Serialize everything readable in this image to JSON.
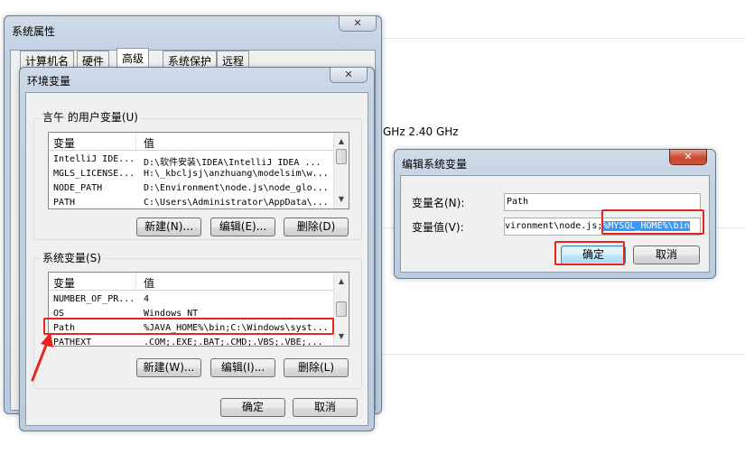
{
  "background": {
    "cpu_text": "GHz   2.40 GHz"
  },
  "system_properties": {
    "title": "系统属性",
    "tabs": [
      "计算机名",
      "硬件",
      "高级",
      "系统保护",
      "远程"
    ],
    "active_tab": 2
  },
  "env_dialog": {
    "title": "环境变量",
    "user_group_label": "言午 的用户变量(U)",
    "columns": [
      "变量",
      "值"
    ],
    "user_vars": [
      {
        "name": "IntelliJ IDE...",
        "value": "D:\\软件安装\\IDEA\\IntelliJ IDEA ..."
      },
      {
        "name": "MGLS_LICENSE...",
        "value": "H:\\_kbcljsj\\anzhuang\\modelsim\\w..."
      },
      {
        "name": "NODE_PATH",
        "value": "D:\\Environment\\node.js\\node_glo..."
      },
      {
        "name": "PATH",
        "value": "C:\\Users\\Administrator\\AppData\\..."
      }
    ],
    "user_buttons": [
      "新建(N)...",
      "编辑(E)...",
      "删除(D)"
    ],
    "system_group_label": "系统变量(S)",
    "system_vars": [
      {
        "name": "NUMBER_OF_PR...",
        "value": "4"
      },
      {
        "name": "OS",
        "value": "Windows_NT"
      },
      {
        "name": "Path",
        "value": "%JAVA_HOME%\\bin;C:\\Windows\\syst..."
      },
      {
        "name": "PATHEXT",
        "value": ".COM;.EXE;.BAT;.CMD;.VBS;.VBE;..."
      }
    ],
    "system_buttons": [
      "新建(W)...",
      "编辑(I)...",
      "删除(L)"
    ],
    "ok_label": "确定",
    "cancel_label": "取消"
  },
  "edit_dialog": {
    "title": "编辑系统变量",
    "name_label": "变量名(N):",
    "name_value": "Path",
    "value_label": "变量值(V):",
    "value_text": "vironment\\node.js;",
    "value_selected": "%MYSQL_HOME%\\bin",
    "ok_label": "确定",
    "cancel_label": "取消"
  },
  "colors": {
    "highlight_red": "#e8251c",
    "selection_blue": "#3399ff"
  }
}
